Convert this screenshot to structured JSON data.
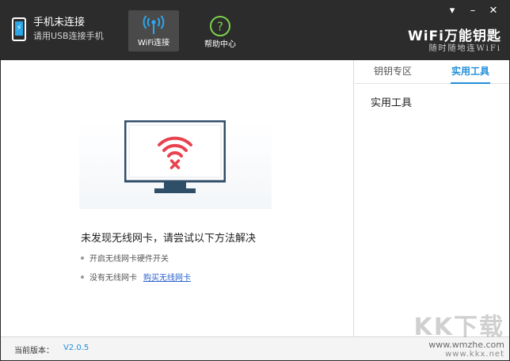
{
  "header": {
    "phone_title": "手机未连接",
    "phone_subtitle": "请用USB连接手机",
    "nav": [
      {
        "label": "WiFi连接",
        "icon": "wifi-antenna-icon",
        "active": true
      },
      {
        "label": "帮助中心",
        "icon": "help-question-icon",
        "active": false
      }
    ],
    "window_controls": {
      "menu": "▾",
      "minimize": "–",
      "close": "✕"
    },
    "brand_main": "WiFi万能钥匙",
    "brand_sub": "随时随地连WiFi"
  },
  "main": {
    "illustration_icon": "monitor-wifi-error-icon",
    "message_title": "未发现无线网卡，请尝试以下方法解决",
    "tips": [
      {
        "text": "开启无线网卡硬件开关"
      },
      {
        "text": "没有无线网卡",
        "link": "购买无线网卡"
      }
    ]
  },
  "sidebar": {
    "tabs": [
      {
        "label": "钥钥专区",
        "active": false
      },
      {
        "label": "实用工具",
        "active": true
      }
    ],
    "section_title": "实用工具"
  },
  "footer": {
    "version_label": "当前版本：",
    "version_value": "V2.0.5"
  },
  "watermark": {
    "main": "KK下载",
    "site": "www.wmzhe.com",
    "site2": "www.kkx.net"
  },
  "colors": {
    "header_bg": "#2c2c2c",
    "accent": "#1f8ed9",
    "wifi_error": "#e8424f",
    "link": "#2c63c9"
  }
}
